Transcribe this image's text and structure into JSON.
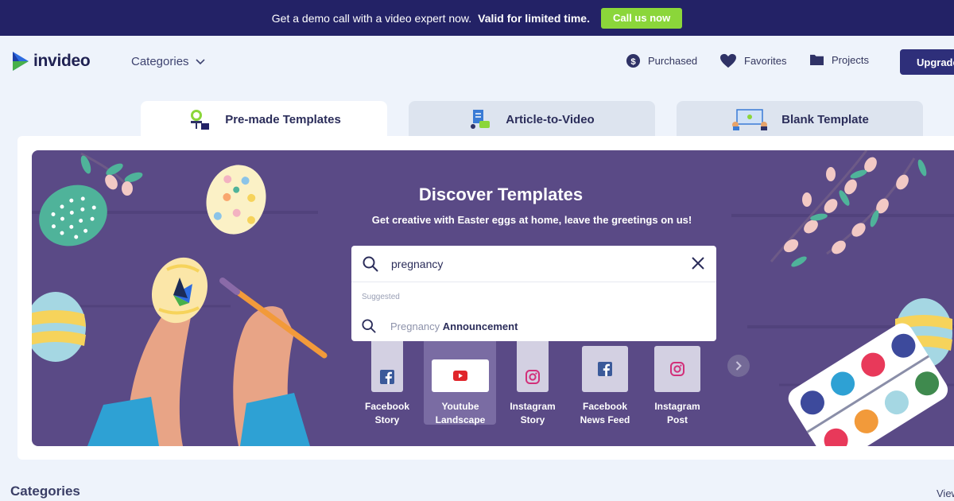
{
  "promo": {
    "text": "Get a demo call with a video expert now.",
    "highlight": "Valid for limited time.",
    "cta_label": "Call us now"
  },
  "header": {
    "logo_text": "invideo",
    "categories_label": "Categories",
    "nav": {
      "purchased": "Purchased",
      "favorites": "Favorites",
      "projects": "Projects"
    },
    "upgrade_label": "Upgrade"
  },
  "tabs": [
    {
      "label": "Pre-made Templates",
      "active": true
    },
    {
      "label": "Article-to-Video",
      "active": false
    },
    {
      "label": "Blank Template",
      "active": false
    }
  ],
  "hero": {
    "title": "Discover Templates",
    "subtitle": "Get creative with Easter eggs at home, leave the greetings on us!"
  },
  "search": {
    "value": "pregnancy",
    "suggested_label": "Suggested",
    "suggestion_prefix": "Pregnancy",
    "suggestion_bold": "Announcement"
  },
  "formats": [
    {
      "line1": "Facebook",
      "line2": "Story",
      "icon": "facebook-icon",
      "selected": false
    },
    {
      "line1": "Youtube",
      "line2": "Landscape",
      "icon": "youtube-icon",
      "selected": true
    },
    {
      "line1": "Instagram",
      "line2": "Story",
      "icon": "instagram-icon",
      "selected": false
    },
    {
      "line1": "Facebook",
      "line2": "News Feed",
      "icon": "facebook-icon",
      "selected": false
    },
    {
      "line1": "Instagram",
      "line2": "Post",
      "icon": "instagram-icon",
      "selected": false
    }
  ],
  "section": {
    "title": "Categories",
    "view_all": "View all"
  },
  "colors": {
    "promo_bg": "#232266",
    "cta_green": "#8bd63a",
    "hero_bg": "#5a4a86",
    "upgrade_bg": "#2e2f7a",
    "page_bg": "#eef3fb"
  }
}
